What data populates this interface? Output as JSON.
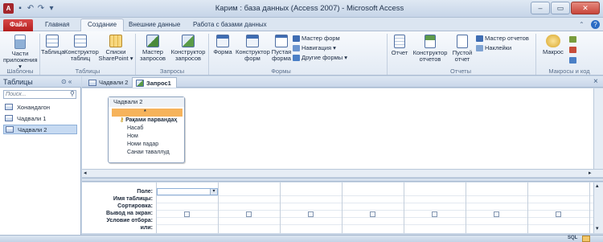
{
  "window": {
    "title": "Карим : база данных (Access 2007) - Microsoft Access",
    "app_icon": "A",
    "min_glyph": "–",
    "max_glyph": "▭",
    "close_glyph": "✕"
  },
  "tabs": [
    "Файл",
    "Главная",
    "Создание",
    "Внешние данные",
    "Работа с базами данных"
  ],
  "help_glyph": "?",
  "ribbon": {
    "groups": {
      "templates": "Шаблоны",
      "tables": "Таблицы",
      "queries": "Запросы",
      "forms": "Формы",
      "reports": "Отчеты",
      "macros": "Макросы и код"
    },
    "buttons": {
      "app_parts": [
        "Части",
        "приложения ▾"
      ],
      "table": [
        "Таблица",
        ""
      ],
      "table_design": [
        "Конструктор",
        "таблиц"
      ],
      "sharepoint_lists": [
        "Списки",
        "SharePoint ▾"
      ],
      "query_wizard": [
        "Мастер",
        "запросов"
      ],
      "query_design": [
        "Конструктор",
        "запросов"
      ],
      "form": [
        "Форма",
        ""
      ],
      "form_design": [
        "Конструктор",
        "форм"
      ],
      "blank_form": [
        "Пустая",
        "форма"
      ],
      "report": [
        "Отчет",
        ""
      ],
      "report_design": [
        "Конструктор",
        "отчетов"
      ],
      "blank_report": [
        "Пустой",
        "отчет"
      ],
      "macro": [
        "Макрос",
        ""
      ]
    },
    "form_small": [
      "Мастер форм",
      "Навигация ▾",
      "Другие формы ▾"
    ],
    "report_small": [
      "Мастер отчетов",
      "Наклейки"
    ]
  },
  "nav": {
    "header": "Таблицы",
    "header_glyphs": "⊙ «",
    "search_placeholder": "Поиск...",
    "items": [
      "Хонандагон",
      "Чадвали 1",
      "Чадвали 2"
    ]
  },
  "doc_tabs": [
    "Чадвали 2",
    "Запрос1"
  ],
  "close_doc_glyph": "×",
  "table_box": {
    "title": "Чадвали 2",
    "fields": [
      "*",
      "Рақами парвандаҳ",
      "Насаб",
      "Ном",
      "Номи падар",
      "Санаи таваллуд"
    ]
  },
  "grid_labels": [
    "Поле:",
    "Имя таблицы:",
    "Сортировка:",
    "Вывод на экран:",
    "Условие отбора:",
    "или:"
  ],
  "status": {
    "sql": "SQL"
  },
  "colors": {
    "file_tab": "#c0282a",
    "accent": "#2b579a"
  }
}
